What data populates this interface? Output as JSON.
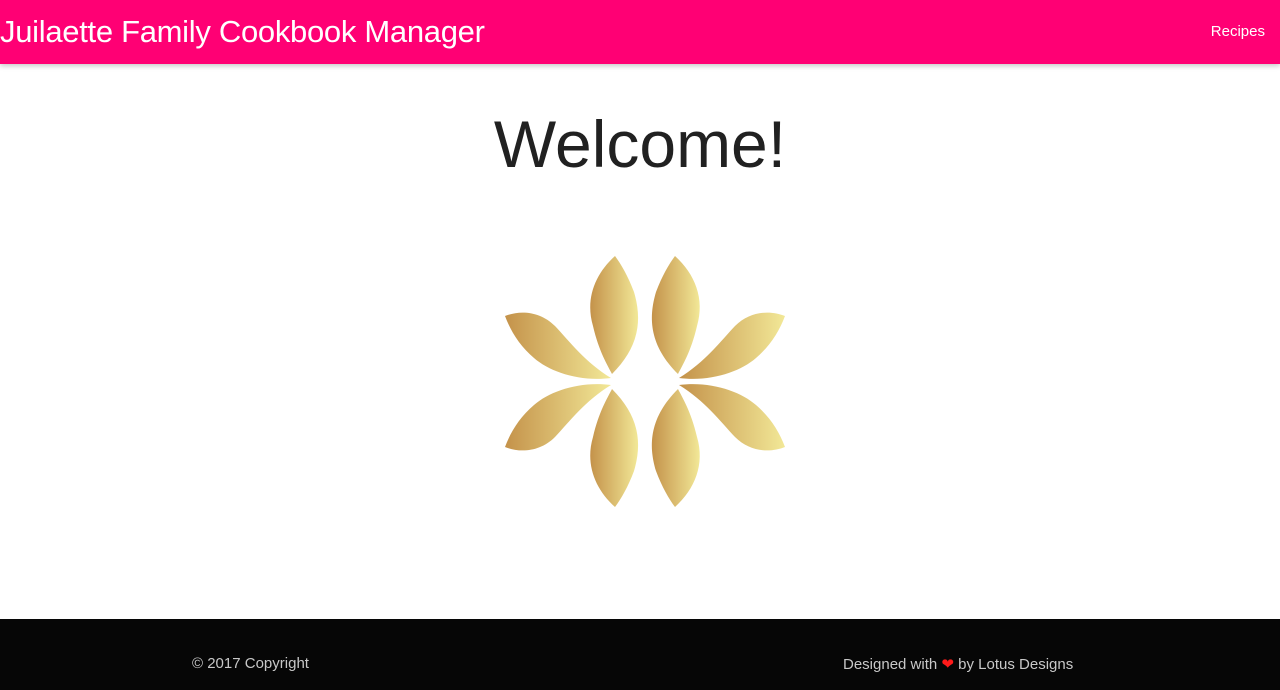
{
  "header": {
    "brand": "Juilaette Family Cookbook Manager",
    "nav_recipes": "Recipes"
  },
  "main": {
    "heading": "Welcome!"
  },
  "footer": {
    "copyright": "© 2017 Copyright",
    "designed_with": "Designed with",
    "heart_glyph": "❤",
    "by": "by",
    "company": "Lotus Designs"
  },
  "colors": {
    "navbar": "#ff0074",
    "footer": "#060606",
    "logo_gradient_start": "#c4924a",
    "logo_gradient_end": "#f2e897",
    "heart": "#ff1a1a"
  },
  "icons": {
    "logo": "gold-flower-logo-icon",
    "heart": "heart-icon"
  }
}
